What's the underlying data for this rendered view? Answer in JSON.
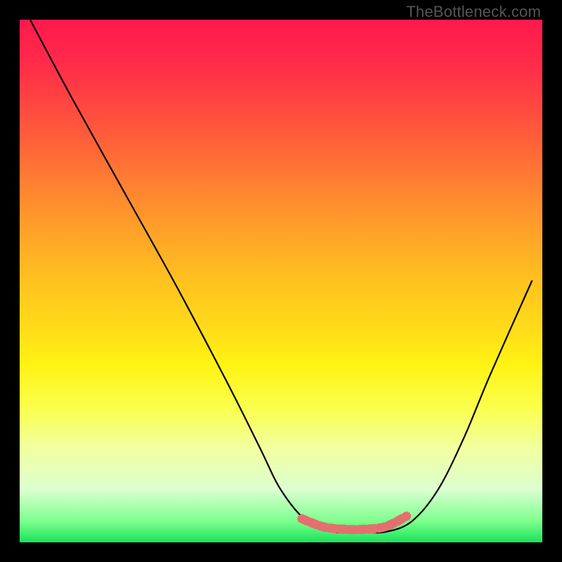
{
  "attribution": "TheBottleneck.com",
  "chart_data": {
    "type": "line",
    "title": "",
    "xlabel": "",
    "ylabel": "",
    "xlim": [
      0,
      100
    ],
    "ylim": [
      0,
      100
    ],
    "series": [
      {
        "name": "bottleneck-curve",
        "x": [
          2,
          10,
          20,
          30,
          40,
          46,
          50,
          55,
          60,
          65,
          70,
          75,
          80,
          85,
          90,
          98
        ],
        "values": [
          100,
          85,
          67,
          49,
          30,
          18,
          10,
          4,
          2,
          2,
          2,
          4,
          10,
          20,
          32,
          50
        ]
      },
      {
        "name": "highlight-band",
        "x": [
          54,
          58,
          62,
          66,
          70,
          74
        ],
        "values": [
          4.5,
          3,
          2.5,
          2.5,
          3,
          5
        ]
      }
    ],
    "colors": {
      "gradient_top": "#ff1a4d",
      "gradient_mid": "#ffde18",
      "gradient_bottom": "#19e35b",
      "curve": "#000000",
      "highlight": "#e46f6f"
    }
  }
}
